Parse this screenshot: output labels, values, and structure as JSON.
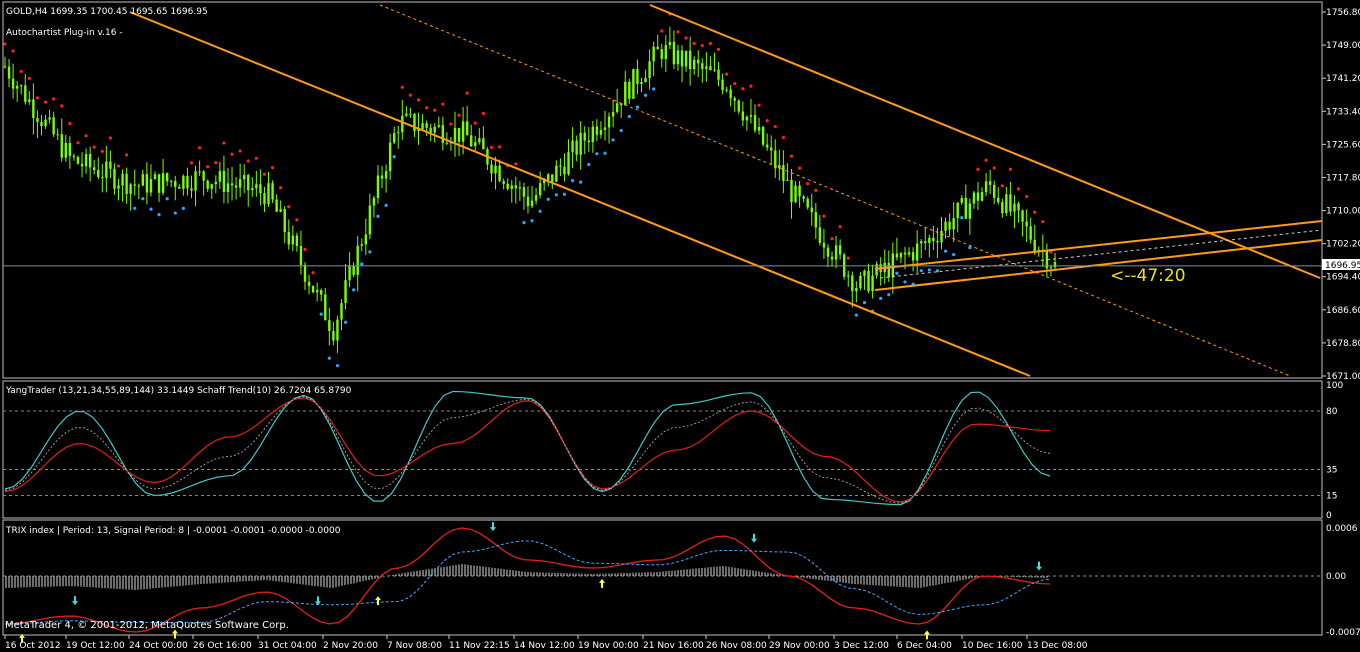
{
  "main": {
    "symbol_line": "GOLD,H4  1699.35 1700.45 1695.65 1696.95",
    "plugin_label": "Autochartist Plug-in v.16 -",
    "current_price": "1696.95",
    "countdown": "<--47:20",
    "yaxis": [
      "1756.80",
      "1749.00",
      "1741.20",
      "1733.40",
      "1725.60",
      "1717.80",
      "1710.00",
      "1702.20",
      "1694.40",
      "1686.60",
      "1678.80",
      "1671.00"
    ]
  },
  "yang": {
    "header": "YangTrader (13,21,34,55,89,144) 33.1449  Schaff Trend(10) 26.7204 65.8790",
    "levels": [
      "100",
      "80",
      "35",
      "15",
      "0"
    ]
  },
  "trix": {
    "header": "TRIX index | Period: 13, Signal Period: 8 |  -0.0001 -0.0001 -0.0000 -0.0000",
    "levels": [
      "0.0006",
      "0.00",
      "-0.0007"
    ]
  },
  "xaxis": [
    "16 Oct 2012",
    "19 Oct 12:00",
    "24 Oct 00:00",
    "26 Oct 16:00",
    "31 Oct 04:00",
    "2 Nov 20:00",
    "7 Nov 08:00",
    "11 Nov 22:15",
    "14 Nov 12:00",
    "19 Nov 00:00",
    "21 Nov 16:00",
    "26 Nov 08:00",
    "29 Nov 00:00",
    "3 Dec 12:00",
    "6 Dec 04:00",
    "10 Dec 16:00",
    "13 Dec 08:00"
  ],
  "footer": "MetaTrader 4, © 2001-2012, MetaQuotes Software Corp.",
  "colors": {
    "candle": "#7cfc00",
    "sar_up": "#ff2020",
    "sar_dn": "#2aa7ff",
    "channel": "#ff9a1a",
    "stc_fast": "#40c8c8",
    "stc_slow": "#e0201f",
    "trix_sig": "#40a8ff",
    "arrow_up": "#ffff40",
    "arrow_dn": "#40e0e0"
  },
  "chart_data": [
    {
      "type": "line",
      "title": "GOLD,H4",
      "x": [
        "16 Oct 2012",
        "19 Oct 12:00",
        "24 Oct 00:00",
        "26 Oct 16:00",
        "31 Oct 04:00",
        "2 Nov 20:00",
        "7 Nov 08:00",
        "11 Nov 22:15",
        "14 Nov 12:00",
        "19 Nov 00:00",
        "21 Nov 16:00",
        "26 Nov 08:00",
        "29 Nov 00:00",
        "3 Dec 12:00",
        "6 Dec 04:00",
        "10 Dec 16:00",
        "13 Dec 08:00"
      ],
      "series": [
        {
          "values": [
            1744,
            1722,
            1716,
            1718,
            1714,
            1682,
            1731,
            1728,
            1712,
            1730,
            1748,
            1740,
            1714,
            1692,
            1702,
            1716,
            1696.95
          ]
        }
      ],
      "ylim": [
        1671.0,
        1756.8
      ]
    },
    {
      "type": "line",
      "title": "YangTrader (13,21,34,55,89,144)",
      "series": [
        {
          "values": [
            20,
            80,
            15,
            30,
            92,
            10,
            95,
            90,
            18,
            85,
            94,
            12,
            8,
            95,
            30
          ]
        },
        {
          "values": [
            18,
            55,
            25,
            60,
            90,
            30,
            55,
            88,
            20,
            50,
            80,
            45,
            10,
            70,
            65
          ]
        }
      ],
      "ylim": [
        0,
        100
      ]
    },
    {
      "type": "line",
      "title": "TRIX index",
      "series": [
        {
          "values": [
            -0.0006,
            -0.0005,
            -0.0007,
            -0.0004,
            -0.0002,
            -0.0006,
            0.0001,
            0.0006,
            0.0002,
            0.0001,
            0.0002,
            0.0005,
            0.0,
            -0.0004,
            -0.0006,
            0.0,
            -0.0001
          ]
        }
      ],
      "ylim": [
        -0.0007,
        0.0006
      ]
    }
  ]
}
